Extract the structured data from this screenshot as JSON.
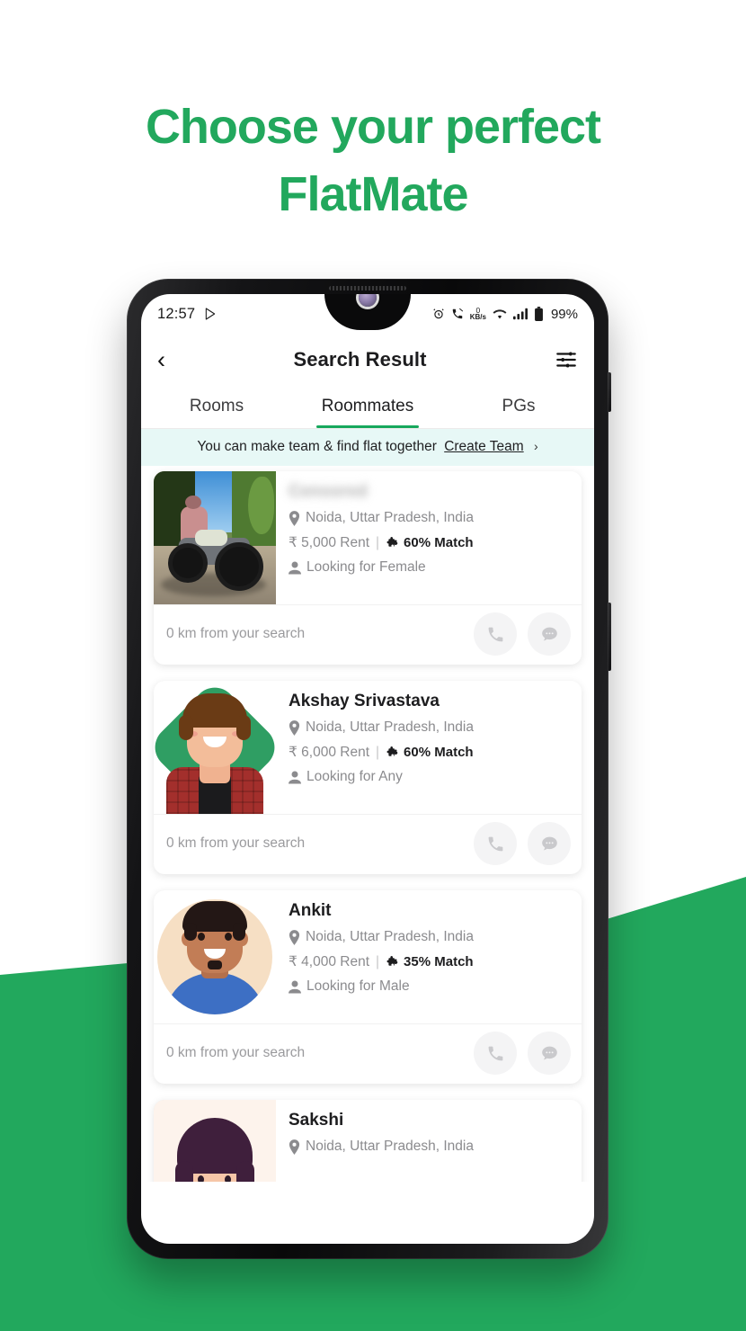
{
  "headline": {
    "line1": "Choose your perfect",
    "line2": "FlatMate",
    "color": "#22a85d"
  },
  "theme": {
    "brand_green": "#22a85d",
    "tab_indicator": "#17a85d",
    "banner_bg": "#e7f8f6",
    "muted_text": "#8b8b8e"
  },
  "status_bar": {
    "time": "12:57",
    "play_icon": "play-store-icon",
    "alarm_icon": "alarm-icon",
    "call_icon": "call-muted-icon",
    "data_speed_value": "0",
    "data_speed_unit": "KB/s",
    "wifi_icon": "wifi-icon",
    "signal_icon": "cellular-signal-icon",
    "battery_icon": "battery-icon",
    "battery_level": "99%"
  },
  "appbar": {
    "back_icon": "back-chevron-icon",
    "title": "Search Result",
    "filter_icon": "filter-sliders-icon"
  },
  "tabs": [
    {
      "label": "Rooms",
      "active": false
    },
    {
      "label": "Roommates",
      "active": true
    },
    {
      "label": "PGs",
      "active": false
    }
  ],
  "banner": {
    "text": "You can make team & find flat together",
    "link_label": "Create Team",
    "chevron": "›"
  },
  "cards": [
    {
      "name": "",
      "name_blurred": true,
      "location": "Noida, Uttar Pradesh, India",
      "rent": "₹ 5,000 Rent",
      "separator": "|",
      "match": "60% Match",
      "looking_for": "Looking for Female",
      "distance": "0 km from your search",
      "avatar": "photo-motorcycle",
      "call_icon": "phone-icon",
      "chat_icon": "chat-bubble-icon"
    },
    {
      "name": "Akshay Srivastava",
      "name_blurred": false,
      "location": "Noida, Uttar Pradesh, India",
      "rent": "₹ 6,000 Rent",
      "separator": "|",
      "match": "60% Match",
      "looking_for": "Looking for Any",
      "distance": "0 km from your search",
      "avatar": "illustration-akshay",
      "call_icon": "phone-icon",
      "chat_icon": "chat-bubble-icon"
    },
    {
      "name": "Ankit",
      "name_blurred": false,
      "location": "Noida, Uttar Pradesh, India",
      "rent": "₹ 4,000 Rent",
      "separator": "|",
      "match": "35% Match",
      "looking_for": "Looking for Male",
      "distance": "0 km from your search",
      "avatar": "illustration-ankit",
      "call_icon": "phone-icon",
      "chat_icon": "chat-bubble-icon"
    },
    {
      "name": "Sakshi",
      "name_blurred": false,
      "location": "Noida, Uttar Pradesh, India",
      "avatar": "illustration-sakshi"
    }
  ]
}
